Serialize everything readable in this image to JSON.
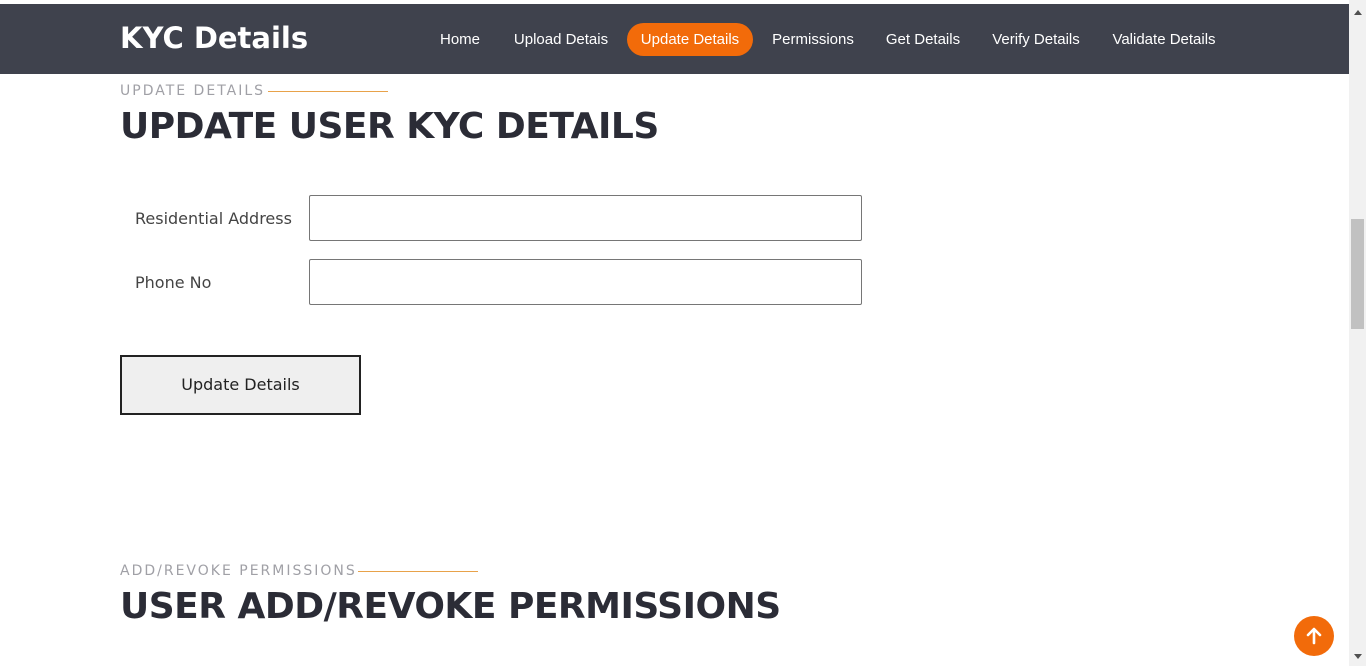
{
  "header": {
    "brand": "KYC Details",
    "nav": [
      {
        "label": "Home",
        "active": false
      },
      {
        "label": "Upload Detais",
        "active": false
      },
      {
        "label": "Update Details",
        "active": true
      },
      {
        "label": "Permissions",
        "active": false
      },
      {
        "label": "Get Details",
        "active": false
      },
      {
        "label": "Verify Details",
        "active": false
      },
      {
        "label": "Validate Details",
        "active": false
      }
    ],
    "colors": {
      "background": "#3f424d",
      "accent": "#f26b0a"
    }
  },
  "update_section": {
    "tag": "UPDATE DETAILS",
    "title": "UPDATE USER KYC DETAILS",
    "fields": [
      {
        "label": "Residential Address",
        "value": "",
        "placeholder": ""
      },
      {
        "label": "Phone No",
        "value": "",
        "placeholder": ""
      }
    ],
    "submit_label": "Update Details"
  },
  "permissions_section": {
    "tag": "ADD/REVOKE PERMISSIONS",
    "title": "USER ADD/REVOKE PERMISSIONS"
  },
  "icons": {
    "back_to_top": "arrow-up-icon",
    "scroll_up": "triangle-up-icon",
    "scroll_down": "triangle-down-icon"
  }
}
